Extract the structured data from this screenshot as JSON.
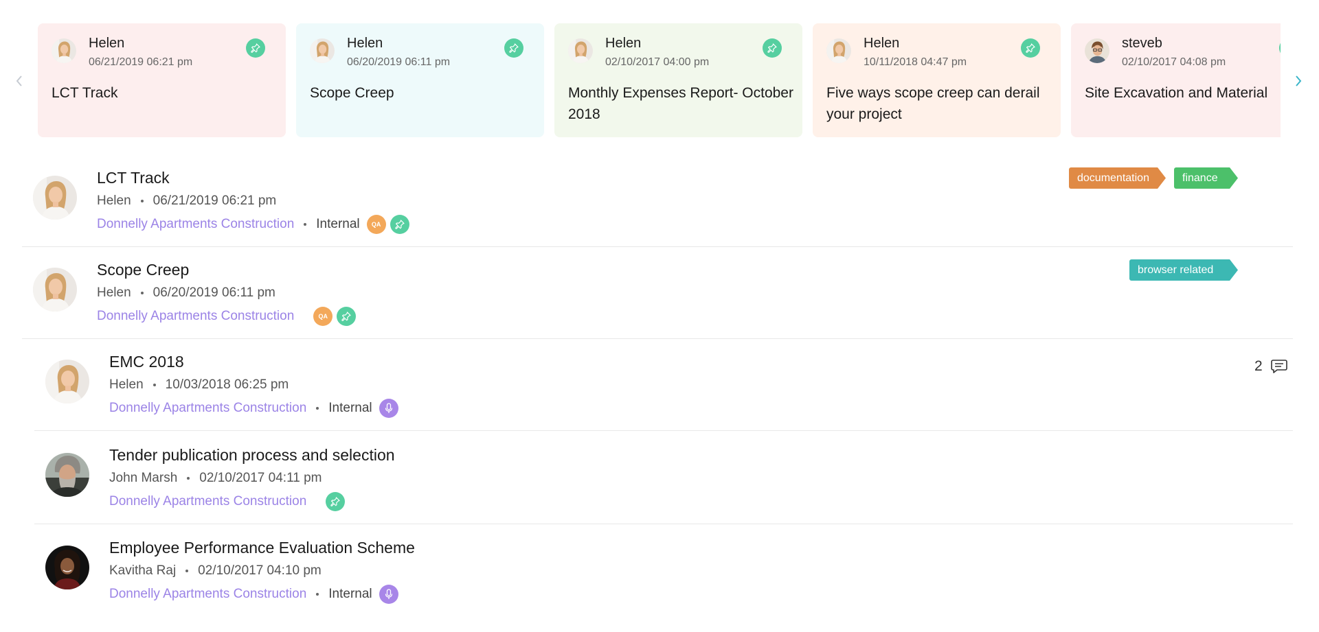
{
  "carousel": {
    "cards": [
      {
        "author": "Helen",
        "time": "06/21/2019 06:21 pm",
        "title": "LCT Track",
        "bg": "#fdeeee",
        "avatar": "helen"
      },
      {
        "author": "Helen",
        "time": "06/20/2019 06:11 pm",
        "title": "Scope Creep",
        "bg": "#eefafb",
        "avatar": "helen"
      },
      {
        "author": "Helen",
        "time": "02/10/2017 04:00 pm",
        "title": "Monthly Expenses Report- October 2018",
        "bg": "#f2f8ec",
        "avatar": "helen"
      },
      {
        "author": "Helen",
        "time": "10/11/2018 04:47 pm",
        "title": "Five ways scope creep can derail your project",
        "bg": "#fff1e9",
        "avatar": "helen"
      },
      {
        "author": "steveb",
        "time": "02/10/2017 04:08 pm",
        "title": "Site Excavation and Material",
        "bg": "#fdeeee",
        "avatar": "steve"
      }
    ]
  },
  "list": [
    {
      "title": "LCT Track",
      "author": "Helen",
      "time": "06/21/2019 06:21 pm",
      "project": "Donnelly Apartments Construction",
      "visibility": "Internal",
      "badges": [
        "qa",
        "pin"
      ],
      "tags": [
        {
          "label": "documentation",
          "color": "#e08a45"
        },
        {
          "label": "finance",
          "color": "#4cc06a"
        }
      ]
    },
    {
      "title": "Scope Creep",
      "author": "Helen",
      "time": "06/20/2019 06:11 pm",
      "project": "Donnelly Apartments Construction",
      "visibility": "",
      "badges": [
        "qa",
        "pin"
      ],
      "tags": [
        {
          "label": "browser related",
          "color": "#3cb8b3"
        }
      ]
    },
    {
      "title": "EMC 2018",
      "author": "Helen",
      "time": "10/03/2018 06:25 pm",
      "project": "Donnelly Apartments Construction",
      "visibility": "Internal",
      "badges": [
        "mic"
      ],
      "comments": "2"
    },
    {
      "title": "Tender publication process and selection",
      "author": "John Marsh",
      "time": "02/10/2017 04:11 pm",
      "project": "Donnelly Apartments Construction",
      "visibility": "",
      "badges": [
        "pin"
      ]
    },
    {
      "title": "Employee Performance Evaluation Scheme",
      "author": "Kavitha Raj",
      "time": "02/10/2017 04:10 pm",
      "project": "Donnelly Apartments Construction",
      "visibility": "Internal",
      "badges": [
        "mic"
      ]
    }
  ],
  "badge_labels": {
    "qa": "QA"
  },
  "icons": [
    "chevron-left-icon",
    "chevron-right-icon",
    "pin-icon",
    "microphone-icon",
    "comment-icon"
  ],
  "colors": {
    "link": "#9b83e6",
    "pin": "#56cfa0",
    "qa": "#f3a85a",
    "mic": "#a886e8",
    "arrow_next": "#3ab5c9"
  }
}
